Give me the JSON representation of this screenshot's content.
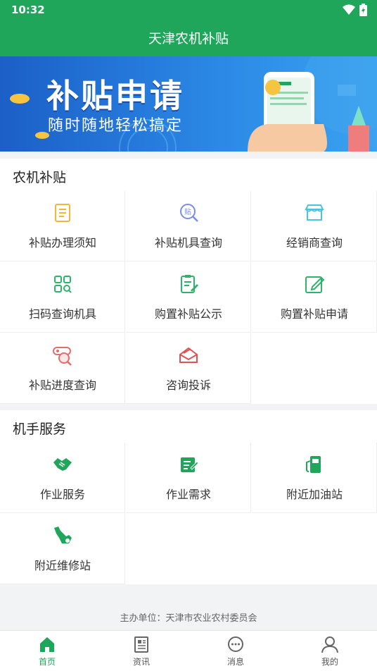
{
  "status": {
    "time": "10:32"
  },
  "header": {
    "title": "天津农机补贴"
  },
  "banner": {
    "title": "补贴申请",
    "subtitle": "随时随地轻松搞定"
  },
  "subsidy": {
    "title": "农机补贴",
    "items": [
      {
        "label": "补贴办理须知",
        "icon": "document-list-icon"
      },
      {
        "label": "补贴机具查询",
        "icon": "search-subsidy-icon"
      },
      {
        "label": "经销商查询",
        "icon": "storefront-icon"
      },
      {
        "label": "扫码查询机具",
        "icon": "scan-grid-icon"
      },
      {
        "label": "购置补贴公示",
        "icon": "clipboard-edit-icon"
      },
      {
        "label": "购置补贴申请",
        "icon": "edit-square-icon"
      },
      {
        "label": "补贴进度查询",
        "icon": "progress-search-icon"
      },
      {
        "label": "咨询投诉",
        "icon": "envelope-icon"
      }
    ]
  },
  "operator": {
    "title": "机手服务",
    "items": [
      {
        "label": "作业服务",
        "icon": "handshake-icon"
      },
      {
        "label": "作业需求",
        "icon": "note-pen-icon"
      },
      {
        "label": "附近加油站",
        "icon": "fuel-station-icon"
      },
      {
        "label": "附近维修站",
        "icon": "repair-wrench-icon"
      }
    ]
  },
  "footer": {
    "host": "主办单位：天津市农业农村委员会"
  },
  "nav": {
    "items": [
      {
        "label": "首页",
        "icon": "home-icon",
        "active": true
      },
      {
        "label": "资讯",
        "icon": "news-icon",
        "active": false
      },
      {
        "label": "消息",
        "icon": "message-icon",
        "active": false
      },
      {
        "label": "我的",
        "icon": "user-icon",
        "active": false
      }
    ]
  },
  "colors": {
    "brand": "#1fa65a",
    "banner": "#2c8ae6"
  }
}
